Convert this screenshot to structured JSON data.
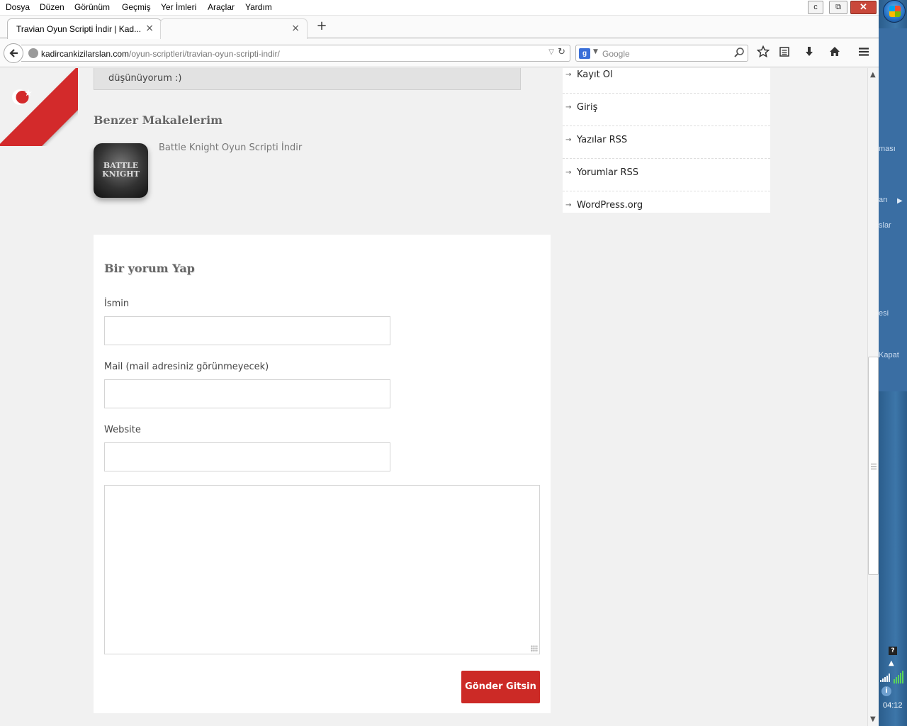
{
  "browser": {
    "menu": [
      "Dosya",
      "Düzen",
      "Görünüm",
      "Geçmiş",
      "Yer İmleri",
      "Araçlar",
      "Yardım"
    ],
    "window_buttons": {
      "minimize": "c",
      "restore": "⧉",
      "close": "✕"
    },
    "tabs": [
      {
        "title": "Travian Oyun Scripti İndir | Kad...",
        "close": "×",
        "active": true
      },
      {
        "title": "",
        "close": "×",
        "active": false
      }
    ],
    "new_tab": "+",
    "url": {
      "domain": "kadircankizilarslan.com",
      "path": "/oyun-scriptleri/travian-oyun-scripti-indir/"
    },
    "search": {
      "engine_letter": "g",
      "placeholder": "Google"
    },
    "toolbar_icons": [
      "star-icon",
      "reading-list-icon",
      "download-icon",
      "home-icon",
      "menu-icon"
    ]
  },
  "taskbar": {
    "panel_texts": [
      "ması",
      "arı",
      "slar",
      "esi",
      "Kapat"
    ],
    "clock": "04:12",
    "help": "?"
  },
  "page": {
    "quote_text": "düşünüyorum :)",
    "related": {
      "heading": "Benzer Makalelerim",
      "items": [
        {
          "title": "Battle Knight Oyun Scripti İndir",
          "thumb_text": "BATTLE KNIGHT"
        }
      ]
    },
    "sidebar_meta": [
      "Kayıt Ol",
      "Giriş",
      "Yazılar RSS",
      "Yorumlar RSS",
      "WordPress.org"
    ],
    "comment_form": {
      "heading": "Bir yorum Yap",
      "name_label": "İsmin",
      "mail_label": "Mail (mail adresiniz görünmeyecek)",
      "website_label": "Website",
      "name_value": "",
      "mail_value": "",
      "website_value": "",
      "comment_value": "",
      "submit_label": "Gönder Gitsin"
    }
  },
  "colors": {
    "accent_red": "#cc2a26",
    "ribbon_red": "#d32a2b",
    "taskbar_blue": "#3a6ea3"
  }
}
